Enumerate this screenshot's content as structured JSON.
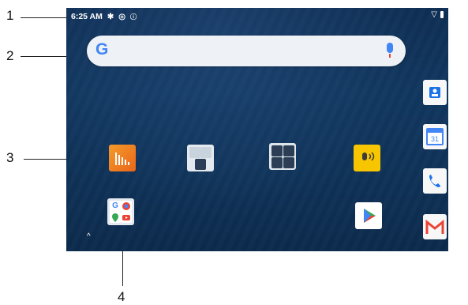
{
  "callouts": [
    "1",
    "2",
    "3",
    "4"
  ],
  "status_bar": {
    "time": "6:25 AM",
    "icons": [
      "settings-gear-icon",
      "sync-icon",
      "info-icon"
    ],
    "right_icons": [
      "wifi-icon",
      "battery-icon"
    ]
  },
  "search_bar": {
    "logo": "G",
    "mic_icon": "microphone-icon"
  },
  "home_apps": [
    {
      "name": "audio-volume-app-icon",
      "color": "#ee7a1a"
    },
    {
      "name": "apps-folder-icon",
      "color": "#dfe7ee"
    },
    {
      "name": "settings-folder-icon",
      "color": "#dfe7ee"
    },
    {
      "name": "ptt-voice-app-icon",
      "color": "#f7c600"
    },
    {
      "name": "google-apps-folder-icon",
      "color": "#e4e9ef"
    },
    {
      "name": "play-store-icon",
      "color": "#ffffff"
    }
  ],
  "dock": [
    {
      "name": "contacts-icon",
      "color": "#1a73e8"
    },
    {
      "name": "calendar-icon",
      "color": "#4285F4",
      "label": "31"
    },
    {
      "name": "phone-icon",
      "color": "#1a73e8"
    },
    {
      "name": "gmail-icon",
      "color": "#ea4335"
    }
  ],
  "nav": {
    "arrow": "^"
  },
  "colors": {
    "wallpaper": "#11375f",
    "search_bg": "#eef2f6"
  }
}
